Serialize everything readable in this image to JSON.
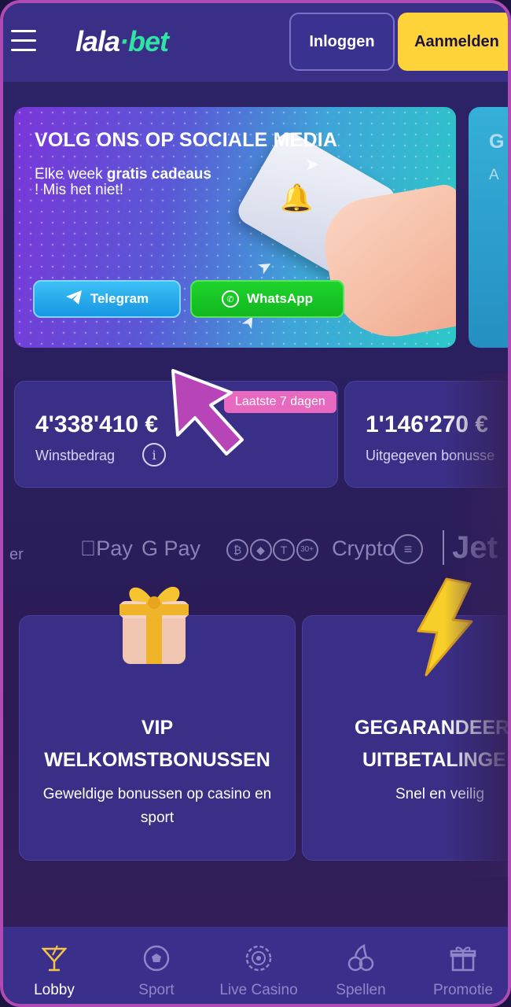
{
  "header": {
    "logo_part1": "lala",
    "logo_dot": "·",
    "logo_part2": "bet",
    "login_label": "Inloggen",
    "register_label": "Aanmelden"
  },
  "banner": {
    "title": "VOLG ONS OP SOCIALE MEDIA",
    "subtitle_prefix": "Elke week ",
    "subtitle_bold": "gratis cadeaus",
    "subtitle_suffix": "! Mis het niet!",
    "telegram_label": "Telegram",
    "whatsapp_label": "WhatsApp",
    "next_banner_peek_title": "G",
    "next_banner_peek_sub": "A"
  },
  "stats": {
    "badge": "Laatste 7 dagen",
    "win_amount": "4'338'410 €",
    "win_label": "Winstbedrag",
    "bonus_amount": "1'146'270 €",
    "bonus_label": "Uitgegeven bonusse"
  },
  "payments": {
    "left_peek": "er",
    "apple_pay": "Pay",
    "google_pay": "G Pay",
    "crypto_plus": "30+",
    "crypto_label": "Crypto",
    "jeton_label": "Jet"
  },
  "features": [
    {
      "title_line1": "VIP",
      "title_line2": "WELKOMSTBONUSSEN",
      "desc": "Geweldige bonussen op casino en sport"
    },
    {
      "title_line1": "GEGARANDEER",
      "title_line2": "UITBETALINGE",
      "desc": "Snel en veilig"
    }
  ],
  "nav": {
    "items": [
      {
        "label": "Lobby",
        "icon": "cocktail-icon",
        "active": true
      },
      {
        "label": "Sport",
        "icon": "football-icon",
        "active": false
      },
      {
        "label": "Live Casino",
        "icon": "casino-chip-icon",
        "active": false
      },
      {
        "label": "Spellen",
        "icon": "cherries-icon",
        "active": false
      },
      {
        "label": "Promotie",
        "icon": "gift-icon",
        "active": false
      }
    ]
  },
  "colors": {
    "header_bg": "#3a2f86",
    "accent_yellow": "#ffd43b",
    "logo_green": "#2fe3a4",
    "badge_pink": "#e86ac0",
    "telegram_blue": "#1796e3",
    "whatsapp_green": "#11b81f"
  }
}
